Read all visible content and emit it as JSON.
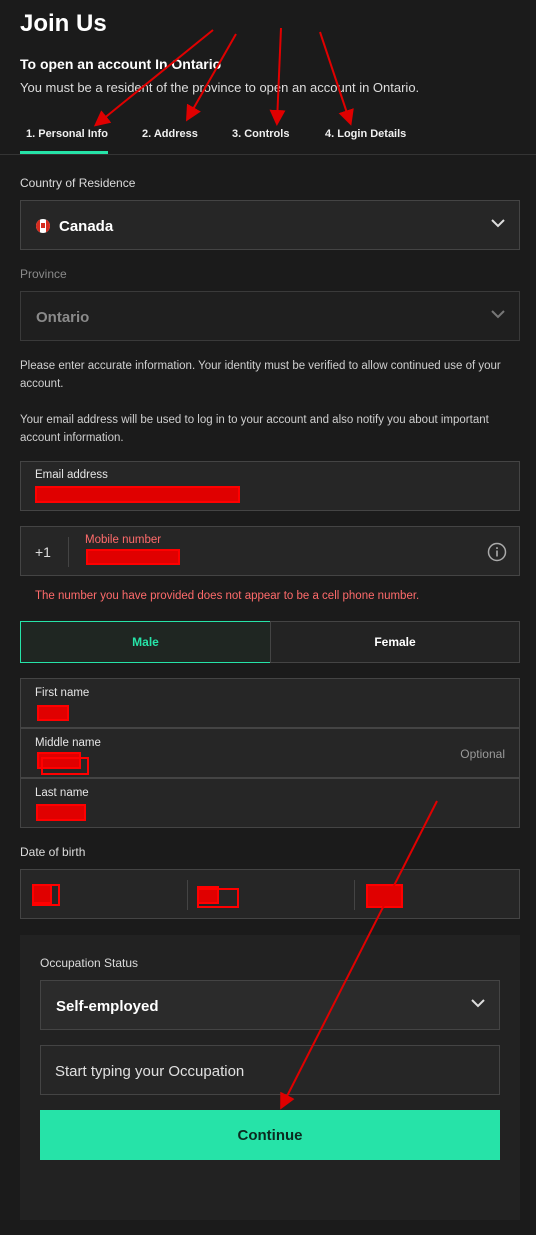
{
  "header": {
    "title": "Join Us",
    "subtitle": "To open an account In Ontario",
    "subtext": "You must be a resident of the province to open an account in Ontario."
  },
  "tabs": [
    {
      "label": "1. Personal Info",
      "active": true
    },
    {
      "label": "2. Address",
      "active": false
    },
    {
      "label": "3. Controls",
      "active": false
    },
    {
      "label": "4. Login Details",
      "active": false
    }
  ],
  "country": {
    "label": "Country of Residence",
    "value": "Canada",
    "flag_icon": "canada-flag-icon"
  },
  "province": {
    "label": "Province",
    "value": "Ontario"
  },
  "info": {
    "identity_notice": "Please enter accurate information. Your identity must be verified to allow continued use of your account.",
    "email_notice": "Your email address will be used to log in to your account and also notify you about important account information."
  },
  "email": {
    "label": "Email address"
  },
  "mobile": {
    "prefix": "+1",
    "label": "Mobile number",
    "info_icon": "info-icon",
    "error": "The number you have provided does not appear to be a cell phone number."
  },
  "gender": {
    "male": "Male",
    "female": "Female",
    "selected": "Male"
  },
  "names": {
    "first_label": "First name",
    "middle_label": "Middle name",
    "middle_hint": "Optional",
    "last_label": "Last name"
  },
  "dob": {
    "label": "Date of birth"
  },
  "occupation": {
    "status_label": "Occupation Status",
    "status_value": "Self-employed",
    "occupation_placeholder": "Start typing your Occupation",
    "continue_label": "Continue"
  },
  "colors": {
    "accent": "#26e3a8",
    "error": "#ff6b6b",
    "annotation": "#e00000",
    "background": "#1b1b1b"
  }
}
